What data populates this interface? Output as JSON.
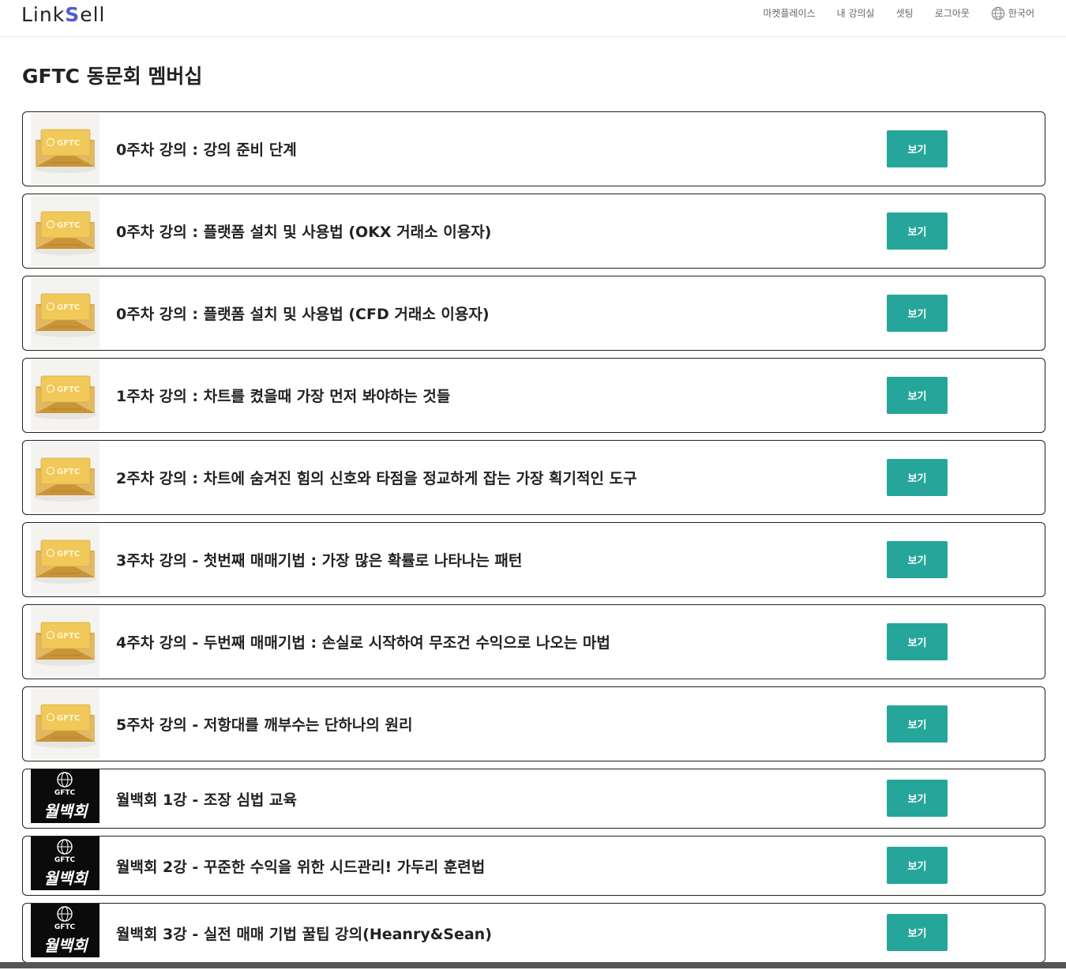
{
  "header": {
    "logo_prefix": "Link",
    "logo_s": "S",
    "logo_suffix": "ell",
    "nav": [
      {
        "label": "마켓플레이스"
      },
      {
        "label": "내 강의실"
      },
      {
        "label": "셋팅"
      },
      {
        "label": "로그아웃"
      },
      {
        "label": "한국어",
        "icon": "globe-icon"
      }
    ]
  },
  "page": {
    "title": "GFTC 동문회 멤버십"
  },
  "courses": [
    {
      "title": "0주차 강의 : 강의 준비 단계",
      "button": "보기",
      "thumb": "gftc-gold-card",
      "thumb_text": "GFTC"
    },
    {
      "title": "0주차 강의 : 플랫폼 설치 및 사용법 (OKX 거래소 이용자)",
      "button": "보기",
      "thumb": "gftc-gold-card",
      "thumb_text": "GFTC"
    },
    {
      "title": "0주차 강의 : 플랫폼 설치 및 사용법 (CFD 거래소 이용자)",
      "button": "보기",
      "thumb": "gftc-gold-card",
      "thumb_text": "GFTC"
    },
    {
      "title": "1주차 강의 : 차트를 켰을때 가장 먼저 봐야하는 것들",
      "button": "보기",
      "thumb": "gftc-gold-card",
      "thumb_text": "GFTC"
    },
    {
      "title": "2주차 강의 : 차트에 숨겨진 힘의 신호와 타점을 정교하게 잡는 가장 획기적인 도구",
      "button": "보기",
      "thumb": "gftc-gold-card",
      "thumb_text": "GFTC"
    },
    {
      "title": "3주차 강의 - 첫번째 매매기법 : 가장 많은 확률로 나타나는 패턴",
      "button": "보기",
      "thumb": "gftc-gold-card",
      "thumb_text": "GFTC"
    },
    {
      "title": "4주차 강의 - 두번째 매매기법 : 손실로 시작하여 무조건 수익으로 나오는 마법",
      "button": "보기",
      "thumb": "gftc-gold-card",
      "thumb_text": "GFTC"
    },
    {
      "title": "5주차 강의 - 저항대를 깨부수는 단하나의 원리",
      "button": "보기",
      "thumb": "gftc-gold-card",
      "thumb_text": "GFTC"
    },
    {
      "title": "월백회 1강 - 조장 심법 교육",
      "button": "보기",
      "thumb": "wolbaekhoe-black",
      "thumb_text": "GFTC",
      "thumb_sub": "월백회"
    },
    {
      "title": "월백회 2강 - 꾸준한 수익을 위한 시드관리! 가두리 훈련법",
      "button": "보기",
      "thumb": "wolbaekhoe-black",
      "thumb_text": "GFTC",
      "thumb_sub": "월백회"
    },
    {
      "title": "월백회 3강 - 실전 매매 기법 꿀팁 강의(Heanry&Sean)",
      "button": "보기",
      "thumb": "wolbaekhoe-black",
      "thumb_text": "GFTC",
      "thumb_sub": "월백회"
    }
  ]
}
